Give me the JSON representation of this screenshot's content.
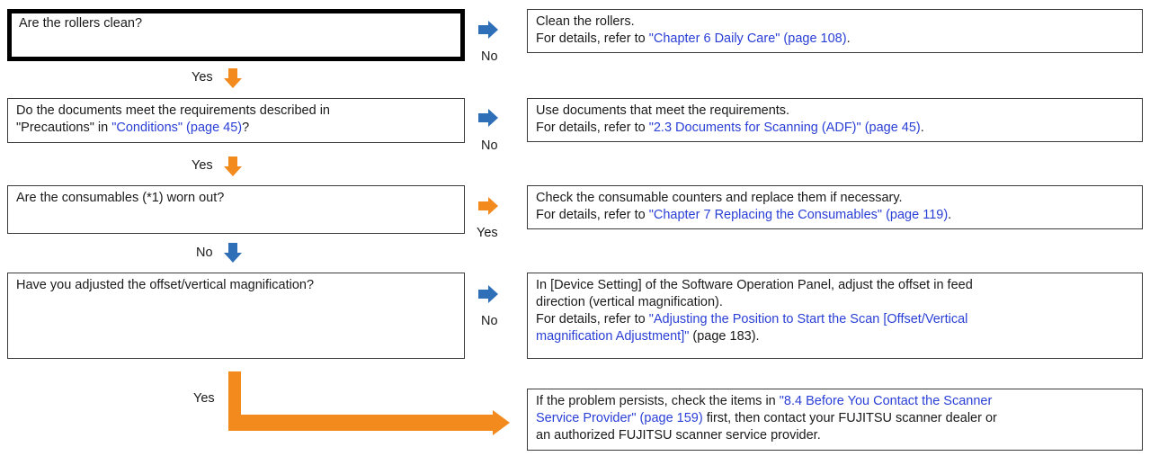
{
  "colors": {
    "orange": "#f28a1e",
    "blue": "#2f6fb8",
    "link": "#2a3fd6"
  },
  "steps": [
    {
      "question": "Are the rollers clean?",
      "branch": "No",
      "down": "Yes",
      "action_text": "Clean the rollers.",
      "refer_prefix": "For details, refer to ",
      "refer_link": "\"Chapter 6 Daily Care\" (page 108)",
      "refer_suffix": "."
    },
    {
      "question_a": "Do the documents meet the requirements described in",
      "question_b": "\"Precautions\" in ",
      "question_link": "\"Conditions\" (page 45)",
      "question_c": "?",
      "branch": "No",
      "down": "Yes",
      "action_text": "Use documents that meet the requirements.",
      "refer_prefix": "For details, refer to ",
      "refer_link": "\"2.3 Documents for Scanning (ADF)\" (page 45)",
      "refer_suffix": "."
    },
    {
      "question": "Are the consumables (*1) worn out?",
      "branch": "Yes",
      "down": "No",
      "action_text": "Check the consumable counters and replace them if necessary.",
      "refer_prefix": "For details, refer to ",
      "refer_link": "\"Chapter 7 Replacing the Consumables\" (page 119)",
      "refer_suffix": "."
    },
    {
      "question": "Have you adjusted the offset/vertical magnification?",
      "branch": "No",
      "down": "Yes",
      "action_text_a": "In [Device Setting] of the Software Operation Panel, adjust the offset in feed",
      "action_text_b": "direction (vertical magnification).",
      "refer_prefix": "For details, refer to ",
      "refer_link_a": "\"Adjusting the Position to Start the Scan [Offset/Vertical",
      "refer_link_b": "magnification Adjustment]\"",
      "refer_suffix": " (page 183)."
    }
  ],
  "final": {
    "prefix": "If the problem persists, check the items in ",
    "link_a": "\"8.4 Before You Contact the Scanner",
    "link_b": "Service Provider\" (page 159)",
    "suffix_a": " first, then contact your FUJITSU scanner dealer or",
    "suffix_b": "an authorized FUJITSU scanner service provider."
  }
}
